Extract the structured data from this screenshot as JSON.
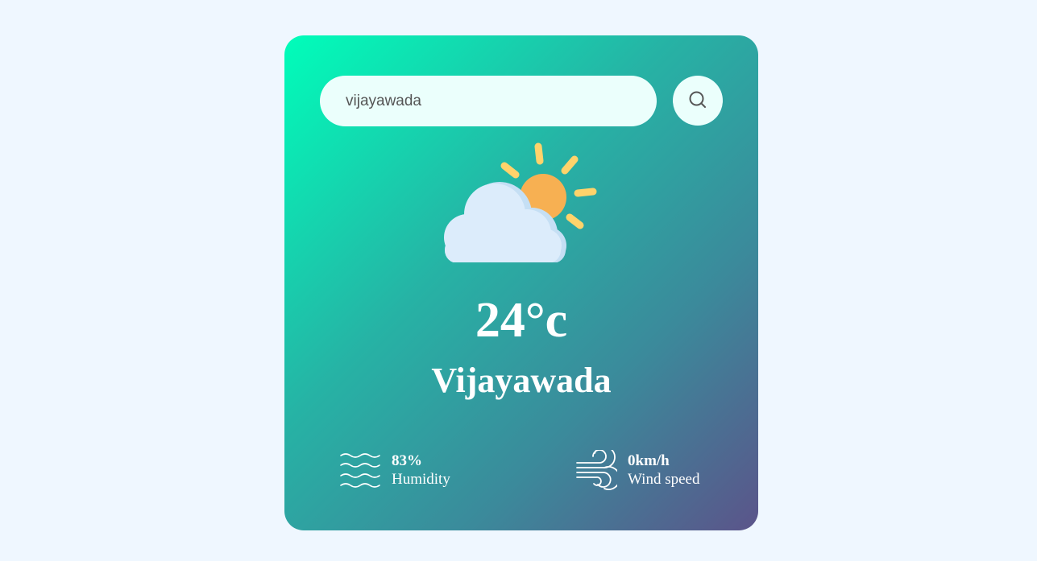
{
  "search": {
    "value": "vijayawada",
    "icon": "search-icon"
  },
  "weather": {
    "icon": "sun-behind-cloud-icon",
    "temperature": "24°c",
    "city": "Vijayawada"
  },
  "details": {
    "humidity": {
      "icon": "humidity-waves-icon",
      "value": "83%",
      "label": "Humidity"
    },
    "wind": {
      "icon": "wind-icon",
      "value": "0km/h",
      "label": "Wind speed"
    }
  },
  "colors": {
    "background": "#eff7ff",
    "card_gradient_start": "#00feba",
    "card_gradient_end": "#5b548a",
    "input_background": "#ebfffc",
    "sun": "#f7b052",
    "sun_rays": "#ffd36b",
    "cloud": "#dcecfb"
  }
}
